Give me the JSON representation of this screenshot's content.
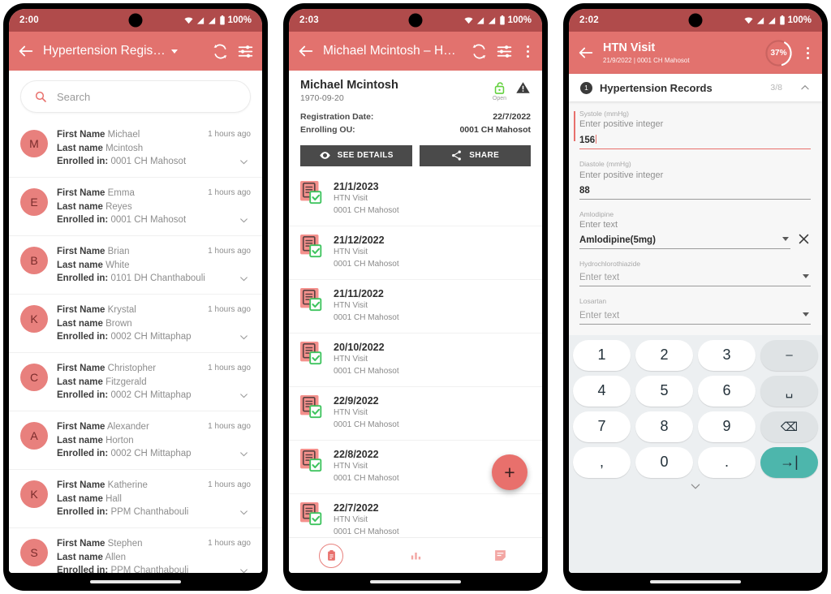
{
  "screen1": {
    "statusbar": {
      "time": "2:00",
      "battery": "100%"
    },
    "appbar": {
      "title": "Hypertension Regis…",
      "back_label": "back",
      "sync_label": "sync",
      "filter_label": "filter"
    },
    "search": {
      "placeholder": "Search"
    },
    "labels": {
      "first_name": "First Name",
      "last_name": "Last name",
      "enrolled_in": "Enrolled in:"
    },
    "items": [
      {
        "initial": "M",
        "first": "Michael",
        "last": "Mcintosh",
        "org": "0001 CH Mahosot",
        "time": "1 hours ago"
      },
      {
        "initial": "E",
        "first": "Emma",
        "last": "Reyes",
        "org": "0001 CH Mahosot",
        "time": "1 hours ago"
      },
      {
        "initial": "B",
        "first": "Brian",
        "last": "White",
        "org": "0101 DH Chanthabouli",
        "time": "1 hours ago"
      },
      {
        "initial": "K",
        "first": "Krystal",
        "last": "Brown",
        "org": "0002 CH Mittaphap",
        "time": "1 hours ago"
      },
      {
        "initial": "C",
        "first": "Christopher",
        "last": "Fitzgerald",
        "org": "0002 CH Mittaphap",
        "time": "1 hours ago"
      },
      {
        "initial": "A",
        "first": "Alexander",
        "last": "Horton",
        "org": "0002 CH Mittaphap",
        "time": "1 hours ago"
      },
      {
        "initial": "K",
        "first": "Katherine",
        "last": "Hall",
        "org": "PPM Chanthabouli",
        "time": "1 hours ago"
      },
      {
        "initial": "S",
        "first": "Stephen",
        "last": "Allen",
        "org": "PPM Chanthabouli",
        "time": "1 hours ago"
      }
    ]
  },
  "screen2": {
    "statusbar": {
      "time": "2:03",
      "battery": "100%"
    },
    "appbar": {
      "title": "Michael Mcintosh – H…"
    },
    "patient": {
      "name": "Michael Mcintosh",
      "dob": "1970-09-20",
      "lock_status": "Open",
      "reg_date_label": "Registration Date:",
      "reg_date_value": "22/7/2022",
      "enroll_ou_label": "Enrolling OU:",
      "enroll_ou_value": "0001 CH Mahosot",
      "see_details_label": "SEE DETAILS",
      "share_label": "SHARE"
    },
    "events": [
      {
        "date": "21/1/2023",
        "program": "HTN Visit",
        "org": "0001 CH Mahosot"
      },
      {
        "date": "21/12/2022",
        "program": "HTN Visit",
        "org": "0001 CH Mahosot"
      },
      {
        "date": "21/11/2022",
        "program": "HTN Visit",
        "org": "0001 CH Mahosot"
      },
      {
        "date": "20/10/2022",
        "program": "HTN Visit",
        "org": "0001 CH Mahosot"
      },
      {
        "date": "22/9/2022",
        "program": "HTN Visit",
        "org": "0001 CH Mahosot"
      },
      {
        "date": "22/8/2022",
        "program": "HTN Visit",
        "org": "0001 CH Mahosot"
      },
      {
        "date": "22/7/2022",
        "program": "HTN Visit",
        "org": "0001 CH Mahosot"
      }
    ],
    "fab_label": "+",
    "bottomnav": [
      {
        "icon": "clipboard-icon",
        "selected": true
      },
      {
        "icon": "bar-chart-icon",
        "selected": false
      },
      {
        "icon": "notes-icon",
        "selected": false
      }
    ]
  },
  "screen3": {
    "statusbar": {
      "time": "2:02",
      "battery": "100%"
    },
    "appbar": {
      "title": "HTN Visit",
      "subtitle": "21/9/2022 | 0001 CH Mahosot",
      "progress": "37%"
    },
    "section": {
      "badge": "1",
      "title": "Hypertension Records",
      "count": "3/8"
    },
    "fields": [
      {
        "label": "Systole (mmHg)",
        "hint": "Enter positive integer",
        "value": "156",
        "type": "text",
        "focused": true,
        "clearable": false
      },
      {
        "label": "Diastole (mmHg)",
        "hint": "Enter positive integer",
        "value": "88",
        "type": "text",
        "focused": false,
        "clearable": false
      },
      {
        "label": "Amlodipine",
        "hint": "Enter text",
        "value": "Amlodipine(5mg)",
        "type": "select",
        "focused": false,
        "clearable": true
      },
      {
        "label": "Hydrochlorothiazide",
        "hint": "",
        "value": "Enter text",
        "type": "select",
        "focused": false,
        "clearable": false
      },
      {
        "label": "Losartan",
        "hint": "",
        "value": "Enter text",
        "type": "select",
        "focused": false,
        "clearable": false
      }
    ],
    "keyboard": {
      "rows": [
        [
          "1",
          "2",
          "3",
          "–"
        ],
        [
          "4",
          "5",
          "6",
          "␣"
        ],
        [
          "7",
          "8",
          "9",
          "⌫"
        ],
        [
          ",",
          "0",
          ".",
          "→|"
        ]
      ]
    }
  },
  "colors": {
    "appbar": "#e2726e",
    "statusbar": "#b04b4b",
    "accent": "#e8706c",
    "avatar": "#e8807d",
    "enter_key": "#4db6ac"
  }
}
